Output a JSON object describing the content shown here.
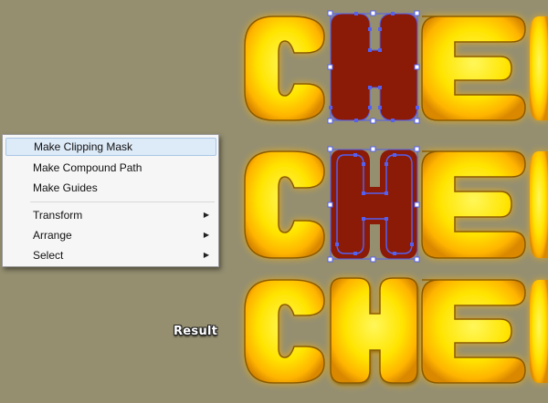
{
  "context_menu": {
    "items": [
      {
        "label": "Make Clipping Mask",
        "highlighted": true
      },
      {
        "label": "Make Compound Path"
      },
      {
        "label": "Make Guides"
      },
      {
        "label": "Transform",
        "submenu": true
      },
      {
        "label": "Arrange",
        "submenu": true
      },
      {
        "label": "Select",
        "submenu": true
      }
    ]
  },
  "canvas": {
    "result_label": "Result",
    "background_color": "#958f70",
    "letter_fill_color": "#ffe600",
    "letter_glow_color": "#ffb300",
    "selected_shape_color": "#8b1a06",
    "selection_handle_color": "#5560f0"
  }
}
